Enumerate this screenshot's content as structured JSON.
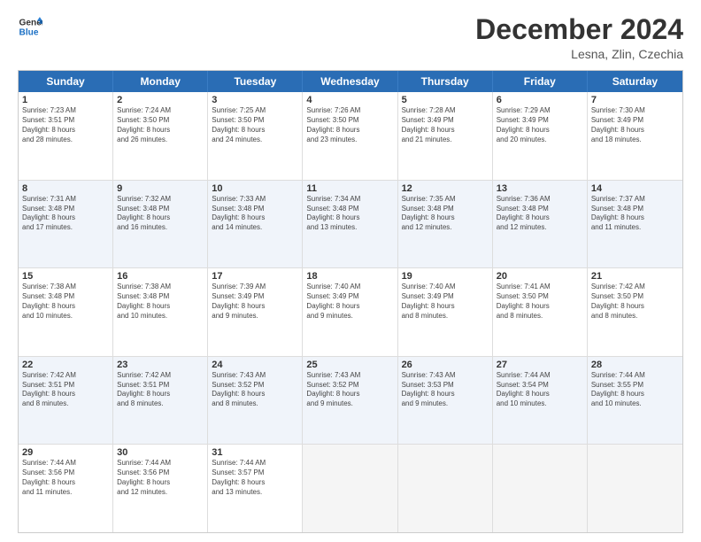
{
  "logo": {
    "line1": "General",
    "line2": "Blue"
  },
  "title": "December 2024",
  "location": "Lesna, Zlin, Czechia",
  "days": [
    "Sunday",
    "Monday",
    "Tuesday",
    "Wednesday",
    "Thursday",
    "Friday",
    "Saturday"
  ],
  "weeks": [
    [
      {
        "day": "1",
        "lines": [
          "Sunrise: 7:23 AM",
          "Sunset: 3:51 PM",
          "Daylight: 8 hours",
          "and 28 minutes."
        ]
      },
      {
        "day": "2",
        "lines": [
          "Sunrise: 7:24 AM",
          "Sunset: 3:50 PM",
          "Daylight: 8 hours",
          "and 26 minutes."
        ]
      },
      {
        "day": "3",
        "lines": [
          "Sunrise: 7:25 AM",
          "Sunset: 3:50 PM",
          "Daylight: 8 hours",
          "and 24 minutes."
        ]
      },
      {
        "day": "4",
        "lines": [
          "Sunrise: 7:26 AM",
          "Sunset: 3:50 PM",
          "Daylight: 8 hours",
          "and 23 minutes."
        ]
      },
      {
        "day": "5",
        "lines": [
          "Sunrise: 7:28 AM",
          "Sunset: 3:49 PM",
          "Daylight: 8 hours",
          "and 21 minutes."
        ]
      },
      {
        "day": "6",
        "lines": [
          "Sunrise: 7:29 AM",
          "Sunset: 3:49 PM",
          "Daylight: 8 hours",
          "and 20 minutes."
        ]
      },
      {
        "day": "7",
        "lines": [
          "Sunrise: 7:30 AM",
          "Sunset: 3:49 PM",
          "Daylight: 8 hours",
          "and 18 minutes."
        ]
      }
    ],
    [
      {
        "day": "8",
        "lines": [
          "Sunrise: 7:31 AM",
          "Sunset: 3:48 PM",
          "Daylight: 8 hours",
          "and 17 minutes."
        ]
      },
      {
        "day": "9",
        "lines": [
          "Sunrise: 7:32 AM",
          "Sunset: 3:48 PM",
          "Daylight: 8 hours",
          "and 16 minutes."
        ]
      },
      {
        "day": "10",
        "lines": [
          "Sunrise: 7:33 AM",
          "Sunset: 3:48 PM",
          "Daylight: 8 hours",
          "and 14 minutes."
        ]
      },
      {
        "day": "11",
        "lines": [
          "Sunrise: 7:34 AM",
          "Sunset: 3:48 PM",
          "Daylight: 8 hours",
          "and 13 minutes."
        ]
      },
      {
        "day": "12",
        "lines": [
          "Sunrise: 7:35 AM",
          "Sunset: 3:48 PM",
          "Daylight: 8 hours",
          "and 12 minutes."
        ]
      },
      {
        "day": "13",
        "lines": [
          "Sunrise: 7:36 AM",
          "Sunset: 3:48 PM",
          "Daylight: 8 hours",
          "and 12 minutes."
        ]
      },
      {
        "day": "14",
        "lines": [
          "Sunrise: 7:37 AM",
          "Sunset: 3:48 PM",
          "Daylight: 8 hours",
          "and 11 minutes."
        ]
      }
    ],
    [
      {
        "day": "15",
        "lines": [
          "Sunrise: 7:38 AM",
          "Sunset: 3:48 PM",
          "Daylight: 8 hours",
          "and 10 minutes."
        ]
      },
      {
        "day": "16",
        "lines": [
          "Sunrise: 7:38 AM",
          "Sunset: 3:48 PM",
          "Daylight: 8 hours",
          "and 10 minutes."
        ]
      },
      {
        "day": "17",
        "lines": [
          "Sunrise: 7:39 AM",
          "Sunset: 3:49 PM",
          "Daylight: 8 hours",
          "and 9 minutes."
        ]
      },
      {
        "day": "18",
        "lines": [
          "Sunrise: 7:40 AM",
          "Sunset: 3:49 PM",
          "Daylight: 8 hours",
          "and 9 minutes."
        ]
      },
      {
        "day": "19",
        "lines": [
          "Sunrise: 7:40 AM",
          "Sunset: 3:49 PM",
          "Daylight: 8 hours",
          "and 8 minutes."
        ]
      },
      {
        "day": "20",
        "lines": [
          "Sunrise: 7:41 AM",
          "Sunset: 3:50 PM",
          "Daylight: 8 hours",
          "and 8 minutes."
        ]
      },
      {
        "day": "21",
        "lines": [
          "Sunrise: 7:42 AM",
          "Sunset: 3:50 PM",
          "Daylight: 8 hours",
          "and 8 minutes."
        ]
      }
    ],
    [
      {
        "day": "22",
        "lines": [
          "Sunrise: 7:42 AM",
          "Sunset: 3:51 PM",
          "Daylight: 8 hours",
          "and 8 minutes."
        ]
      },
      {
        "day": "23",
        "lines": [
          "Sunrise: 7:42 AM",
          "Sunset: 3:51 PM",
          "Daylight: 8 hours",
          "and 8 minutes."
        ]
      },
      {
        "day": "24",
        "lines": [
          "Sunrise: 7:43 AM",
          "Sunset: 3:52 PM",
          "Daylight: 8 hours",
          "and 8 minutes."
        ]
      },
      {
        "day": "25",
        "lines": [
          "Sunrise: 7:43 AM",
          "Sunset: 3:52 PM",
          "Daylight: 8 hours",
          "and 9 minutes."
        ]
      },
      {
        "day": "26",
        "lines": [
          "Sunrise: 7:43 AM",
          "Sunset: 3:53 PM",
          "Daylight: 8 hours",
          "and 9 minutes."
        ]
      },
      {
        "day": "27",
        "lines": [
          "Sunrise: 7:44 AM",
          "Sunset: 3:54 PM",
          "Daylight: 8 hours",
          "and 10 minutes."
        ]
      },
      {
        "day": "28",
        "lines": [
          "Sunrise: 7:44 AM",
          "Sunset: 3:55 PM",
          "Daylight: 8 hours",
          "and 10 minutes."
        ]
      }
    ],
    [
      {
        "day": "29",
        "lines": [
          "Sunrise: 7:44 AM",
          "Sunset: 3:56 PM",
          "Daylight: 8 hours",
          "and 11 minutes."
        ]
      },
      {
        "day": "30",
        "lines": [
          "Sunrise: 7:44 AM",
          "Sunset: 3:56 PM",
          "Daylight: 8 hours",
          "and 12 minutes."
        ]
      },
      {
        "day": "31",
        "lines": [
          "Sunrise: 7:44 AM",
          "Sunset: 3:57 PM",
          "Daylight: 8 hours",
          "and 13 minutes."
        ]
      },
      null,
      null,
      null,
      null
    ]
  ]
}
